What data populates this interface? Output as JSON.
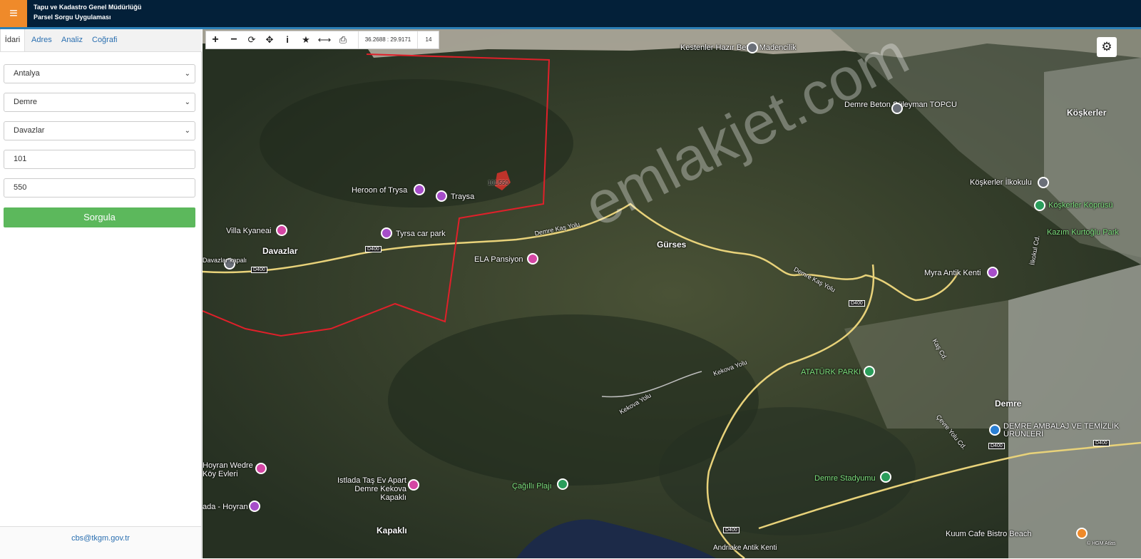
{
  "header": {
    "menu_icon": "≡",
    "org_title": "Tapu ve Kadastro Genel Müdürlüğü",
    "app_title": "Parsel Sorgu Uygulaması",
    "colors": {
      "bar": "#032039",
      "menu": "#ef8a2a"
    }
  },
  "sidebar": {
    "tabs": [
      {
        "label": "İdari",
        "active": true
      },
      {
        "label": "Adres"
      },
      {
        "label": "Analiz"
      },
      {
        "label": "Coğrafi"
      }
    ],
    "fields": {
      "province": "Antalya",
      "district": "Demre",
      "neighborhood": "Davazlar",
      "block": "101",
      "parcel": "550"
    },
    "query_button": "Sorgula",
    "footer_email": "cbs@tkgm.gov.tr"
  },
  "toolbar": {
    "buttons": [
      "+",
      "−",
      "⟳",
      "✥",
      "i",
      "★",
      "⟷",
      "⎙"
    ],
    "coordinates": "36.2688 : 29.9171",
    "zoom": "14"
  },
  "map": {
    "parcel_label": "101/550",
    "watermark": "emlakjet.com",
    "places": [
      "Kestenler Hazır Beton Madencilik",
      "Demre Beton Süleyman TOPCU",
      "Köşkerler",
      "Köşkerler İlkokulu",
      "Köşkerler Köprüsü",
      "Kazım Kurtoğlu Park",
      "Heroon of Trysa",
      "Traysa",
      "Villa Kyaneai",
      "Tyrsa car park",
      "Davazlar",
      "Davazlar kapalı",
      "ELA Pansiyon",
      "Gürses",
      "Myra Antik Kenti",
      "ATATÜRK PARKI",
      "Demre",
      "DEMRE AMBALAJ VE TEMİZLİK ÜRÜNLERİ",
      "Hoyran Wedre Köy Evleri",
      "Istlada Taş Ev Apart Demre Kekova Kapaklı",
      "Çağıllı Plajı",
      "Demre Stadyumu",
      "ada - Hoyran",
      "Kapaklı",
      "Kuum Cafe Bistro Beach",
      "Andriake Antik Kenti"
    ],
    "roads": [
      "D400",
      "Demre Kaş Yolu",
      "Kekova Yolu",
      "Çevre Yolu Cd.",
      "Kaş Cd.",
      "İlkokul Cd."
    ],
    "attribution": "© HGM Atlas",
    "colors": {
      "parcel_border": "#e0202a",
      "road": "#e8d27a",
      "water": "#1c2a48"
    }
  }
}
